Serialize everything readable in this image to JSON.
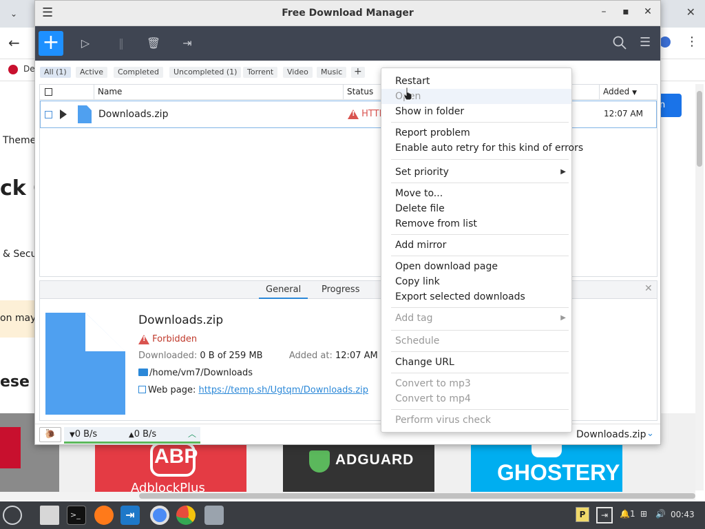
{
  "browser": {
    "tab_close": "✕",
    "bookmark_label": "De",
    "web_themes": "Themes",
    "web_heading": "ck C",
    "web_security": "& Secu",
    "web_banner": "on may",
    "web_heading2": "ese a",
    "blue_button_label": "n",
    "tiles": {
      "abp_logo": "ABP",
      "abp_sub": "AdblockPlus",
      "adguard": "ADGUARD",
      "ghostery": "GHOSTERY"
    }
  },
  "window": {
    "title": "Free Download Manager",
    "minimize": "✕",
    "restore": "▪",
    "close": "✕"
  },
  "filters": {
    "all": "All (1)",
    "active": "Active",
    "completed": "Completed",
    "uncompleted": "Uncompleted (1)",
    "torrent": "Torrent",
    "video": "Video",
    "music": "Music",
    "add": "+"
  },
  "list": {
    "headers": {
      "name": "Name",
      "status": "Status",
      "added": "Added"
    },
    "row": {
      "name": "Downloads.zip",
      "status": "HTTP",
      "added": "12:07 AM"
    }
  },
  "details": {
    "tabs": {
      "general": "General",
      "progress": "Progress"
    },
    "file_name": "Downloads.zip",
    "error": "Forbidden",
    "downloaded_label": "Downloaded:",
    "downloaded_value": "0 B of 259 MB",
    "added_label": "Added at:",
    "added_value": "12:07 AM",
    "path": "/home/vm7/Downloads",
    "webpage_label": "Web page:",
    "webpage_url": "https://temp.sh/Ugtqm/Downloads.zip"
  },
  "statusbar": {
    "down_speed": "0 B/s",
    "up_speed": "0 B/s",
    "selected_file": "Downloads.zip"
  },
  "context_menu": {
    "restart": "Restart",
    "open": "Open",
    "show_in_folder": "Show in folder",
    "report_problem": "Report problem",
    "auto_retry": "Enable auto retry for this kind of errors",
    "set_priority": "Set priority",
    "move_to": "Move to...",
    "delete_file": "Delete file",
    "remove_from_list": "Remove from list",
    "add_mirror": "Add mirror",
    "open_download_page": "Open download page",
    "copy_link": "Copy link",
    "export_selected": "Export selected downloads",
    "add_tag": "Add tag",
    "schedule": "Schedule",
    "change_url": "Change URL",
    "convert_mp3": "Convert to mp3",
    "convert_mp4": "Convert to mp4",
    "virus_check": "Perform virus check"
  },
  "taskbar": {
    "tray_badge": "1",
    "clock": "00:43"
  },
  "colors": {
    "accent_blue": "#1e90ff",
    "toolbar_dark": "#3f4552",
    "error_red": "#d9534f",
    "taskbar": "#3a3d42"
  },
  "icons": {
    "menu": "hamburger-icon",
    "add": "plus-icon",
    "resume": "play-icon",
    "pause": "pause-icon",
    "delete": "trash-icon",
    "move": "folder-move-icon",
    "search": "search-icon",
    "main_menu": "hamburger-icon"
  }
}
